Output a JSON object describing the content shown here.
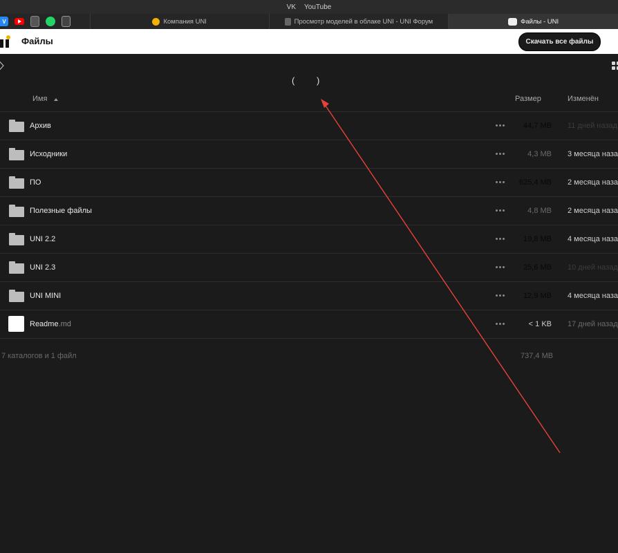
{
  "bookmarks": {
    "items": [
      "VK",
      "YouTube"
    ]
  },
  "tabs": [
    {
      "label": "Компания UNI",
      "icon": "uni-icon",
      "active": false
    },
    {
      "label": "Просмотр моделей в облаке UNI - UNI Форум",
      "icon": "forum-icon",
      "active": false
    },
    {
      "label": "Файлы - UNI",
      "icon": "files-icon",
      "active": true
    }
  ],
  "header": {
    "title": "Файлы",
    "download_label": "Скачать все файлы"
  },
  "center_text": "( )",
  "columns": {
    "name": "Имя",
    "size": "Размер",
    "modified": "Изменён"
  },
  "rows": [
    {
      "name": "Архив",
      "ext": "",
      "type": "folder",
      "size": "44,7 MB",
      "modified": "11 дней назад",
      "size_color": "#080808",
      "mod_color": "#3c3c3c"
    },
    {
      "name": "Исходники",
      "ext": "",
      "type": "folder",
      "size": "4,3 MB",
      "modified": "3 месяца назад",
      "size_color": "#6a6a6a",
      "mod_color": "#cfcfcf"
    },
    {
      "name": "ПО",
      "ext": "",
      "type": "folder",
      "size": "625,4 MB",
      "modified": "2 месяца назад",
      "size_color": "#080808",
      "mod_color": "#cfcfcf"
    },
    {
      "name": "Полезные файлы",
      "ext": "",
      "type": "folder",
      "size": "4,8 MB",
      "modified": "2 месяца назад",
      "size_color": "#6a6a6a",
      "mod_color": "#cfcfcf"
    },
    {
      "name": "UNI 2.2",
      "ext": "",
      "type": "folder",
      "size": "19,8 MB",
      "modified": "4 месяца назад",
      "size_color": "#080808",
      "mod_color": "#cfcfcf"
    },
    {
      "name": "UNI 2.3",
      "ext": "",
      "type": "folder",
      "size": "25,6 MB",
      "modified": "10 дней назад",
      "size_color": "#080808",
      "mod_color": "#3c3c3c"
    },
    {
      "name": "UNI MINI",
      "ext": "",
      "type": "folder",
      "size": "12,9 MB",
      "modified": "4 месяца назад",
      "size_color": "#080808",
      "mod_color": "#cfcfcf"
    },
    {
      "name": "Readme",
      "ext": ".md",
      "type": "file",
      "size": "< 1 KB",
      "modified": "17 дней назад",
      "size_color": "#cfcfcf",
      "mod_color": "#6a6a6a"
    }
  ],
  "summary": {
    "left": "7 каталогов и 1 файл",
    "right": "737,4 MB"
  },
  "colors": {
    "annotation_arrow": "#e8413a",
    "accent": "#f1b300"
  }
}
